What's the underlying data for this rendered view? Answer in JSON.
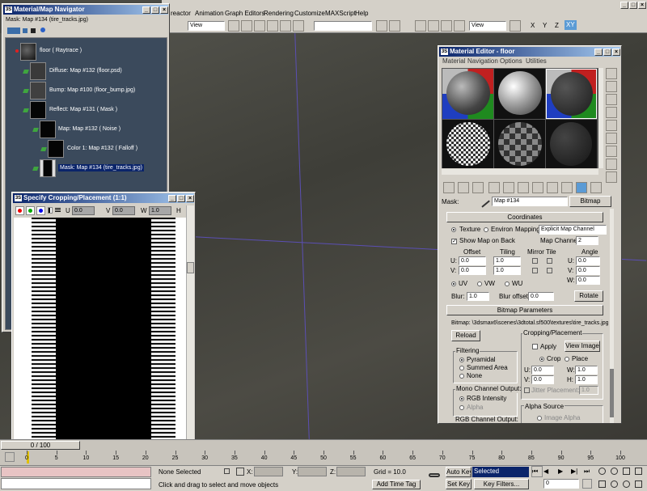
{
  "menubar": {
    "items": [
      "reactor",
      "Animation",
      "Graph Editors",
      "Rendering",
      "Customize",
      "MAXScript",
      "Help"
    ]
  },
  "toolbar": {
    "view1": "View",
    "view2": "View",
    "axes": [
      "X",
      "Y",
      "Z",
      "XY"
    ]
  },
  "navigator": {
    "title": "Material/Map Navigator",
    "current": "Mask: Map #134 (tire_tracks.jpg)",
    "nodes": [
      "floor  ( Raytrace )",
      "Diffuse: Map #132 (floor.psd)",
      "Bump: Map #100 (floor_bump.jpg)",
      "Reflect: Map #131  ( Mask )",
      "Map: Map #132  ( Noise )",
      "Color 1: Map #132  ( Falloff )",
      "Mask: Map #134 (tire_tracks.jpg)"
    ]
  },
  "crop": {
    "title": "Specify Cropping/Placement (1:1)",
    "u_label": "U",
    "u_value": "0.0",
    "v_label": "V",
    "v_value": "0.0",
    "w_label": "W",
    "w_value": "1.0",
    "h_label": "H"
  },
  "mated": {
    "title": "Material Editor - floor",
    "menu": [
      "Material",
      "Navigation",
      "Options",
      "Utilities"
    ],
    "mask_label": "Mask:",
    "map_name": "Map #134",
    "map_type": "Bitmap",
    "coords": {
      "header": "Coordinates",
      "texture": "Texture",
      "environ": "Environ",
      "mapping_label": "Mapping:",
      "mapping_value": "Explicit Map Channel",
      "show_map": "Show Map on Back",
      "map_channel_label": "Map Channel:",
      "map_channel_value": "2",
      "offset": "Offset",
      "tiling": "Tiling",
      "mirror_tile": "Mirror Tile",
      "angle": "Angle",
      "u_label": "U:",
      "v_label": "V:",
      "w_label": "W:",
      "offset_u": "0.0",
      "offset_v": "0.0",
      "tiling_u": "1.0",
      "tiling_v": "1.0",
      "angle_u": "0.0",
      "angle_v": "0.0",
      "angle_w": "0.0",
      "uv": "UV",
      "vw": "VW",
      "wu": "WU",
      "blur_label": "Blur:",
      "blur_value": "1.0",
      "blur_offset_label": "Blur offset:",
      "blur_offset_value": "0.0",
      "rotate": "Rotate"
    },
    "bitmap": {
      "header": "Bitmap Parameters",
      "path": "Bitmap:  \\3dsmax6\\scenes\\3dtotal.sf500\\textures\\tire_tracks.jpg",
      "reload": "Reload",
      "filtering": "Filtering",
      "pyramidal": "Pyramidal",
      "summed": "Summed Area",
      "none": "None",
      "mono_output": "Mono Channel Output:",
      "rgb_intensity": "RGB Intensity",
      "alpha": "Alpha",
      "rgb_output": "RGB Channel Output:",
      "cropping": "Cropping/Placement",
      "apply": "Apply",
      "view_image": "View Image",
      "crop": "Crop",
      "place": "Place",
      "u_label": "U:",
      "v_label": "V:",
      "w_label": "W:",
      "h_label": "H:",
      "u": "0.0",
      "v": "0.0",
      "w": "1.0",
      "h": "1.0",
      "jitter": "Jitter Placement:",
      "jitter_value": "1.0",
      "alpha_source": "Alpha Source",
      "image_alpha": "Image Alpha"
    }
  },
  "timeline": {
    "frame": "0 / 100",
    "ticks": [
      "0",
      "5",
      "10",
      "15",
      "20",
      "25",
      "30",
      "35",
      "40",
      "45",
      "50",
      "55",
      "60",
      "65",
      "70",
      "75",
      "80",
      "85",
      "90",
      "95",
      "100"
    ]
  },
  "status": {
    "selection": "None Selected",
    "prompt": "Click and drag to select and move objects",
    "x_label": "X:",
    "y_label": "Y:",
    "z_label": "Z:",
    "grid": "Grid = 10.0",
    "add_time_tag": "Add Time Tag",
    "auto_key": "Auto Key",
    "set_key": "Set Key",
    "selected": "Selected",
    "key_filters": "Key Filters...",
    "frame_value": "0"
  },
  "colors": {
    "title_active": "#0a246a",
    "viewport": "#4a4a44",
    "accent_purple": "#5b4fb4"
  }
}
